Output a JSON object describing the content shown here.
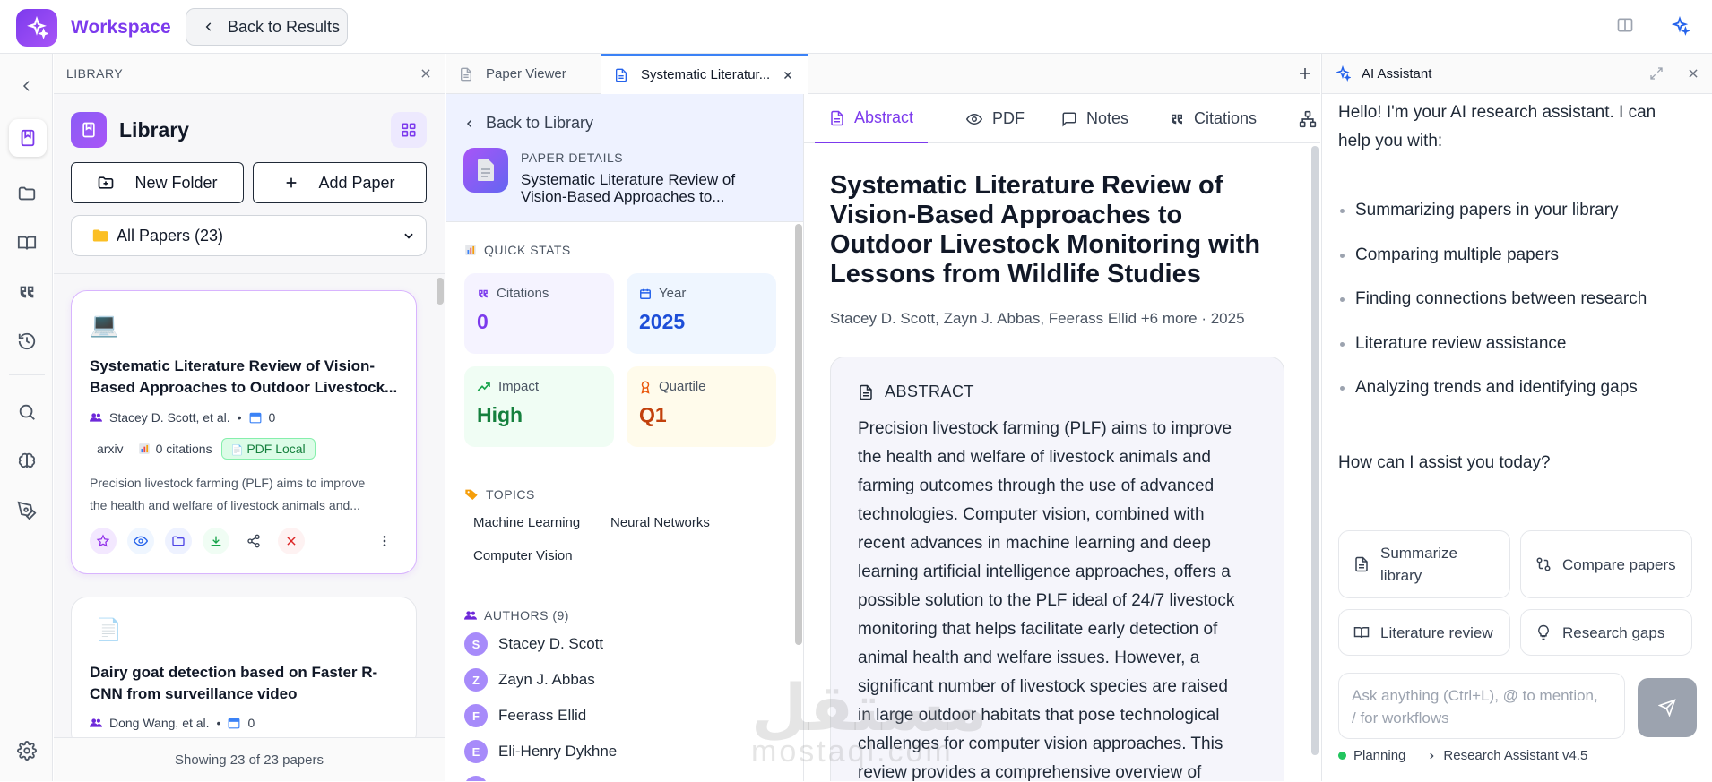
{
  "topbar": {
    "brand": "Workspace",
    "back_label": "Back to Results"
  },
  "library": {
    "header": "LIBRARY",
    "title": "Library",
    "new_folder": "New Folder",
    "add_paper": "Add Paper",
    "filter_selected": "All Papers (23)",
    "footer": "Showing 23 of 23 papers",
    "cards": [
      {
        "icon": "💻",
        "title_1": "Systematic Literature Review of Vision-",
        "title_2": "Based Approaches to Outdoor Livestock...",
        "authors": "Stacey D. Scott, et al.",
        "year": "0",
        "source": "arxiv",
        "citations": "0 citations",
        "badge": "PDF Local",
        "desc_1": "Precision livestock farming (PLF) aims to improve",
        "desc_2": "the health and welfare of livestock animals and..."
      },
      {
        "icon": "📄",
        "title_1": "Dairy goat detection based on Faster R-",
        "title_2": "CNN from surveillance video",
        "authors": "Dong Wang, et al.",
        "year": "0"
      }
    ]
  },
  "tabs": [
    {
      "label": "Paper Viewer"
    },
    {
      "label": "Systematic Literatur..."
    }
  ],
  "details": {
    "label": "PAPER DETAILS",
    "title_1": "Systematic Literature Review of",
    "title_2": "Vision-Based Approaches to...",
    "back": "Back to Library",
    "quick_stats": "QUICK STATS",
    "stats": {
      "citations_label": "Citations",
      "citations": "0",
      "year_label": "Year",
      "year": "2025",
      "impact_label": "Impact",
      "impact": "High",
      "quartile_label": "Quartile",
      "quartile": "Q1"
    },
    "topics_label": "TOPICS",
    "topics": [
      "Machine Learning",
      "Neural Networks",
      "Computer Vision"
    ],
    "authors_label": "AUTHORS (9)",
    "authors": [
      {
        "initial": "S",
        "name": "Stacey D. Scott"
      },
      {
        "initial": "Z",
        "name": "Zayn J. Abbas"
      },
      {
        "initial": "F",
        "name": "Feerass Ellid"
      },
      {
        "initial": "E",
        "name": "Eli-Henry Dykhne"
      }
    ]
  },
  "reader": {
    "tabs": [
      "Abstract",
      "PDF",
      "Notes",
      "Citations"
    ],
    "title_lines": [
      "Systematic Literature Review of",
      "Vision-Based Approaches to",
      "Outdoor Livestock Monitoring with",
      "Lessons from Wildlife Studies"
    ],
    "authors": "Stacey D. Scott, Zayn J. Abbas, Feerass Ellid +6 more · 2025",
    "abstract_label": "ABSTRACT",
    "abstract_lines": [
      "Precision livestock farming (PLF) aims to improve",
      "the health and welfare of livestock animals and",
      "farming outcomes through the use of advanced",
      "technologies. Computer vision, combined with",
      "recent advances in machine learning and deep",
      "learning artificial intelligence approaches, offers a",
      "possible solution to the PLF ideal of 24/7 livestock",
      "monitoring that helps facilitate early detection of",
      "animal health and welfare issues. However, a",
      "significant number of livestock species are raised",
      "in large outdoor habitats that pose technological",
      "challenges for computer vision approaches. This",
      "review provides a comprehensive overview of"
    ]
  },
  "ai": {
    "title": "AI Assistant",
    "greeting_1": "Hello! I'm your AI research assistant. I can",
    "greeting_2": "help you with:",
    "items": [
      "Summarizing papers in your library",
      "Comparing multiple papers",
      "Finding connections between research",
      "Literature review assistance",
      "Analyzing trends and identifying gaps"
    ],
    "question": "How can I assist you today?",
    "actions": {
      "summarize_1": "Summarize",
      "summarize_2": "library",
      "compare": "Compare papers",
      "review": "Literature review",
      "gaps": "Research gaps"
    },
    "input_line_1": "Ask anything (Ctrl+L), @ to mention,",
    "input_line_2": "/ for workflows",
    "mode": "Planning",
    "model": "Research Assistant v4.5"
  },
  "colors": {
    "accent": "#7c3aed",
    "blue": "#1d4ed8",
    "green": "#15803d",
    "orange": "#c2410c"
  },
  "watermark": {
    "line1": "مستقل",
    "line2": "mostaql.com"
  }
}
